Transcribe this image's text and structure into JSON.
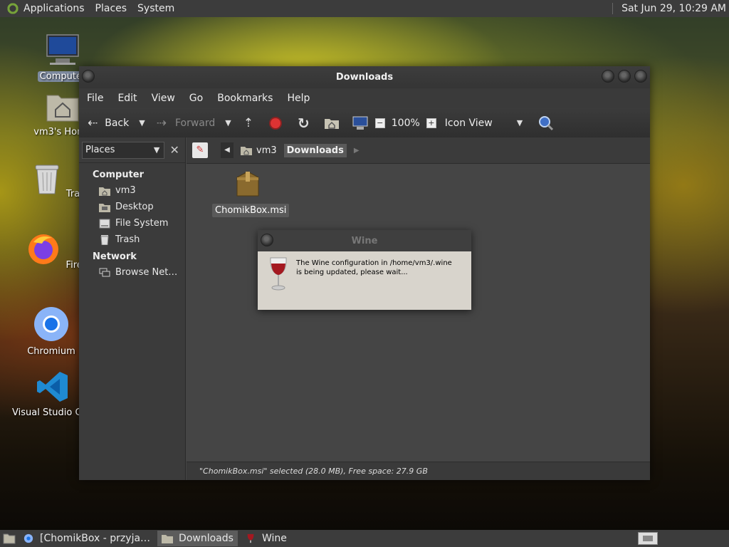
{
  "top_panel": {
    "menus": [
      "Applications",
      "Places",
      "System"
    ],
    "clock": "Sat Jun 29, 10:29 AM"
  },
  "desktop": {
    "icons": [
      {
        "label": "Computer",
        "icon": "monitor-icon"
      },
      {
        "label": "vm3's Home",
        "icon": "home-folder-icon"
      },
      {
        "label": "Trash",
        "icon": "trash-icon"
      },
      {
        "label": "Firefox",
        "icon": "firefox-icon"
      },
      {
        "label": "Chromium",
        "icon": "chromium-icon"
      },
      {
        "label": "Visual Studio Code",
        "icon": "vscode-icon"
      }
    ]
  },
  "window": {
    "title": "Downloads",
    "menu": [
      "File",
      "Edit",
      "View",
      "Go",
      "Bookmarks",
      "Help"
    ],
    "toolbar": {
      "back": "Back",
      "forward": "Forward",
      "zoom": "100%",
      "view_mode": "Icon View"
    },
    "sidebar": {
      "selector": "Places",
      "groups": [
        {
          "title": "Computer",
          "items": [
            "vm3",
            "Desktop",
            "File System",
            "Trash"
          ]
        },
        {
          "title": "Network",
          "items": [
            "Browse Net…"
          ]
        }
      ]
    },
    "path": [
      "vm3",
      "Downloads"
    ],
    "files": [
      {
        "name": "ChomikBox.msi",
        "icon": "package-icon"
      }
    ],
    "status": "\"ChomikBox.msi\" selected (28.0 MB), Free space: 27.9 GB"
  },
  "dialog": {
    "title": "Wine",
    "message": "The Wine configuration in /home/vm3/.wine is being updated, please wait..."
  },
  "taskbar": {
    "tasks": [
      "[ChomikBox - przyja…",
      "Downloads",
      "Wine"
    ]
  }
}
